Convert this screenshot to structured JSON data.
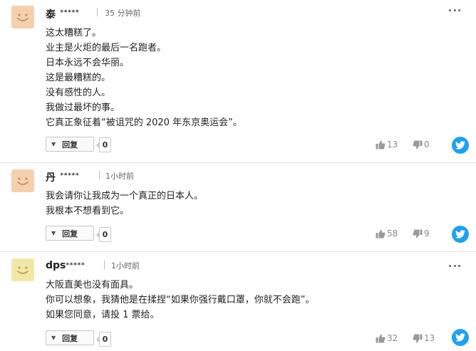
{
  "colors": {
    "avatar_peach": "#f6cfad",
    "avatar_yellow": "#f3e7a8",
    "twitter": "#1da1f2",
    "text": "#222222",
    "muted": "#888888"
  },
  "comments": [
    {
      "name": "泰",
      "masked_id": "*****",
      "time": "35 分钟前",
      "lines": [
        "这太糟糕了。",
        "业主是火炬的最后一名跑者。",
        "日本永远不会华丽。",
        "这是最糟糕的。",
        "没有感性的人。",
        "我做过最坏的事。",
        "它真正象征着“被诅咒的 2020 年东京奥运会”。"
      ],
      "reply_label": "回复",
      "reply_count": "0",
      "likes": "13",
      "dislikes": "0",
      "avatar_color": "#f6cfad"
    },
    {
      "name": "丹",
      "masked_id": "*****",
      "time": "1小时前",
      "lines": [
        "我会请你让我成为一个真正的日本人。",
        "我根本不想看到它。"
      ],
      "reply_label": "回复",
      "reply_count": "0",
      "likes": "58",
      "dislikes": "9",
      "avatar_color": "#f6cfad"
    },
    {
      "name": "dps",
      "masked_id": "*****",
      "time": "1小时前",
      "lines": [
        "大阪直美也没有面具。",
        "你可以想象，我猜他是在揉捏“如果你强行戴口罩，你就不会跑”。",
        "如果您同意，请投 1 票给。"
      ],
      "reply_label": "回复",
      "reply_count": "0",
      "likes": "32",
      "dislikes": "13",
      "avatar_color": "#f3e7a8"
    }
  ]
}
